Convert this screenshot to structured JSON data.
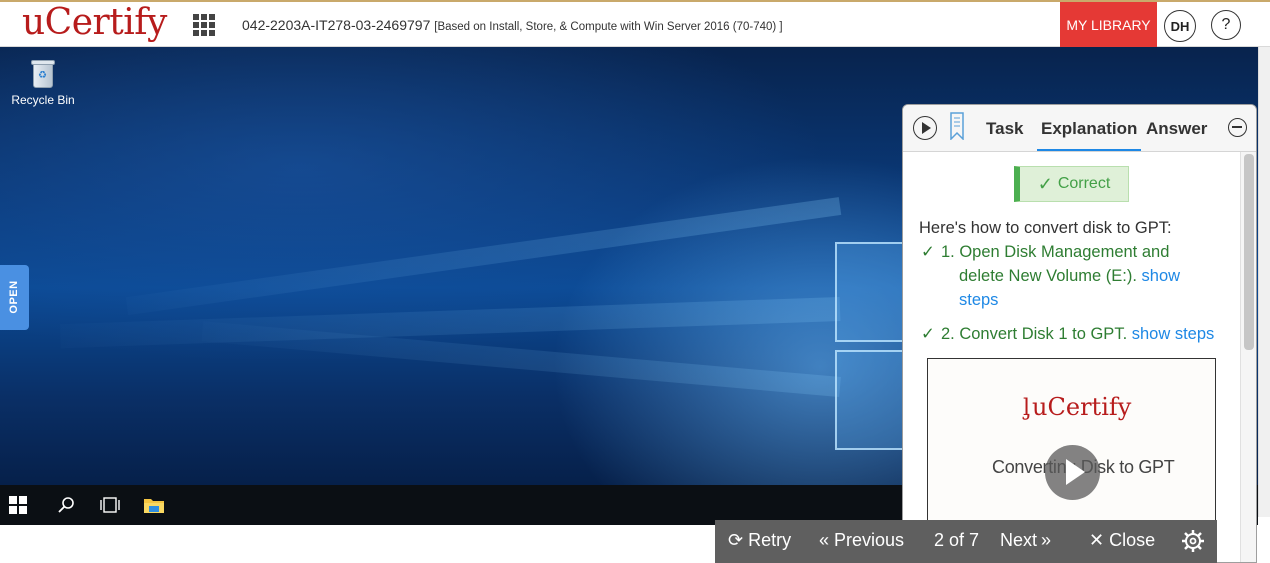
{
  "header": {
    "logo": "uCertify",
    "course_code": "042-2203A-IT278-03-2469797",
    "course_subtitle": "[Based on Install, Store, & Compute with Win Server 2016 (70-740) ]",
    "library_label": "MY LIBRARY",
    "avatar_initials": "DH",
    "help_label": "?"
  },
  "desktop": {
    "recycle_bin_label": "Recycle Bin",
    "open_tab_label": "OPEN"
  },
  "taskbar": {
    "icons": [
      "windows-start-icon",
      "search-icon",
      "task-view-icon",
      "file-explorer-icon"
    ]
  },
  "panel": {
    "tabs": {
      "task": "Task",
      "explanation": "Explanation",
      "answer": "Answer"
    },
    "active_tab": "Explanation",
    "status": "Correct",
    "intro": "Here's how to convert disk to GPT:",
    "steps": [
      {
        "line1": "1. Open Disk Management and",
        "line2": "delete New Volume (E:).",
        "link_a": "show",
        "link_b": "steps"
      },
      {
        "line1": "2. Convert Disk 1 to GPT.",
        "link": "show steps"
      }
    ],
    "video": {
      "logo": "uCertify",
      "title": "Converting Disk to GPT"
    }
  },
  "toolbar": {
    "retry": "Retry",
    "previous": "Previous",
    "page": "2 of 7",
    "next": "Next",
    "close": "Close"
  },
  "colors": {
    "brand_red": "#b71c1c",
    "library_button": "#e53935",
    "correct_green": "#43a047",
    "link_blue": "#1e88e5",
    "toolbar_bg": "#5f5f5f"
  }
}
